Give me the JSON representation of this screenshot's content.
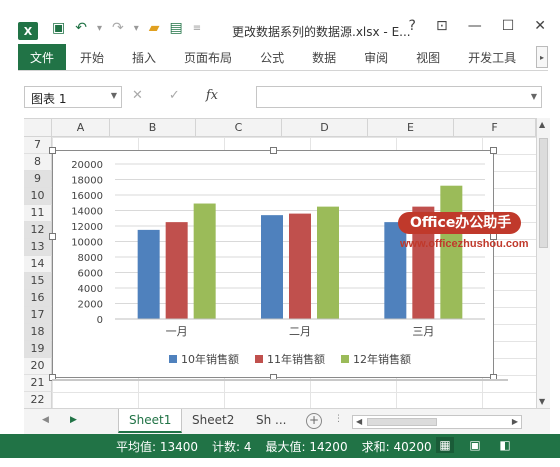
{
  "window": {
    "app_icon_label": "X",
    "title": "更改数据系列的数据源.xlsx - E...",
    "controls": [
      "?",
      "⊡",
      "—",
      "☐",
      "✕"
    ]
  },
  "ribbon": {
    "tabs": [
      "文件",
      "开始",
      "插入",
      "页面布局",
      "公式",
      "数据",
      "审阅",
      "视图",
      "开发工具"
    ],
    "scroll_glyph": "▸"
  },
  "formula_bar": {
    "name_box": "图表 1",
    "cancel": "✕",
    "enter": "✓",
    "fx": "fx",
    "value": ""
  },
  "grid": {
    "columns": [
      "A",
      "B",
      "C",
      "D",
      "E",
      "F"
    ],
    "rows": [
      "7",
      "8",
      "9",
      "10",
      "11",
      "12",
      "13",
      "14",
      "15",
      "16",
      "17",
      "18",
      "19",
      "20",
      "21",
      "22"
    ],
    "highlighted_rows": [
      "9",
      "10",
      "12",
      "13",
      "15",
      "16",
      "17",
      "18",
      "19"
    ]
  },
  "chart_data": {
    "type": "bar",
    "categories": [
      "一月",
      "二月",
      "三月"
    ],
    "series": [
      {
        "name": "10年销售额",
        "color": "#4f81bd",
        "values": [
          11500,
          13400,
          12500
        ]
      },
      {
        "name": "11年销售额",
        "color": "#c0504d",
        "values": [
          12500,
          13600,
          14500
        ]
      },
      {
        "name": "12年销售额",
        "color": "#9bbb59",
        "values": [
          14900,
          14500,
          17200
        ]
      }
    ],
    "yticks": [
      "20000",
      "18000",
      "16000",
      "14000",
      "12000",
      "10000",
      "8000",
      "6000",
      "4000",
      "2000",
      "0"
    ],
    "ylim": [
      0,
      20000
    ],
    "legend_position": "bottom",
    "grid": true
  },
  "watermark": {
    "brand": "Office办公助手",
    "url": "www.officezhushou.com"
  },
  "sheets": {
    "tabs": [
      "Sheet1",
      "Sheet2",
      "Sh ..."
    ],
    "active": "Sheet1",
    "add": "+"
  },
  "status": {
    "average": "平均值: 13400",
    "count": "计数: 4",
    "max": "最大值: 14200",
    "sum": "求和: 40200"
  }
}
